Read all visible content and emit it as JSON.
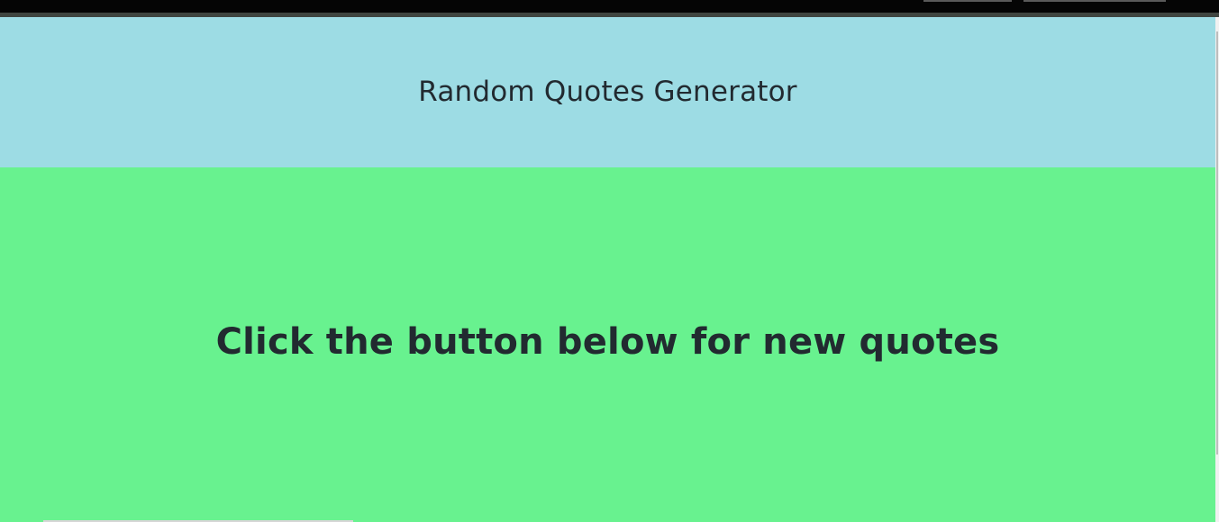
{
  "header": {
    "title": "Random Quotes Generator"
  },
  "main": {
    "message": "Click the button below for new quotes"
  },
  "colors": {
    "header_bg": "#9ddce4",
    "main_bg": "#68f28f",
    "text": "#222a30"
  }
}
